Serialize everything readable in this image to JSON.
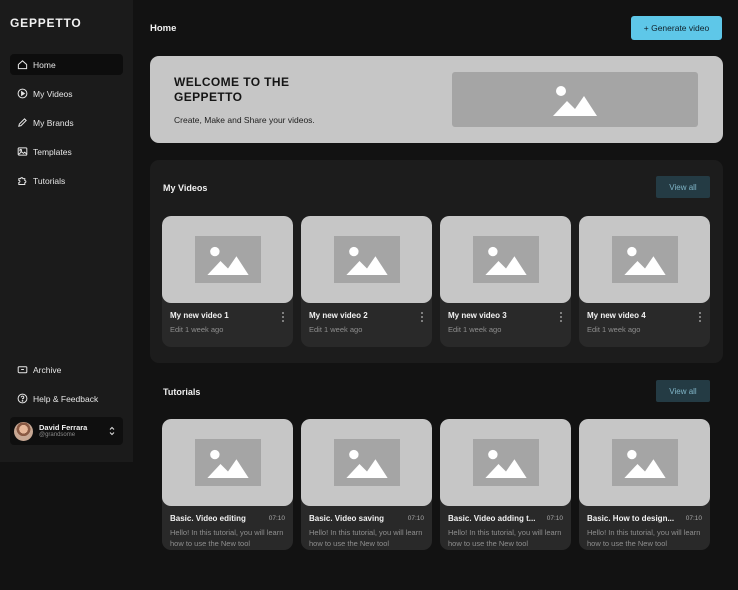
{
  "app": {
    "logo": "GEPPETTO"
  },
  "sidebar": {
    "items": [
      {
        "label": "Home",
        "icon": "home-icon"
      },
      {
        "label": "My Videos",
        "icon": "play-circle-icon"
      },
      {
        "label": "My Brands",
        "icon": "pencil-icon"
      },
      {
        "label": "Templates",
        "icon": "image-icon"
      },
      {
        "label": "Tutorials",
        "icon": "puzzle-icon"
      }
    ],
    "bottom_items": [
      {
        "label": "Archive",
        "icon": "archive-icon"
      },
      {
        "label": "Help & Feedback",
        "icon": "help-icon"
      }
    ],
    "user": {
      "name": "David Ferrara",
      "handle": "@grandsome"
    }
  },
  "header": {
    "title": "Home",
    "generate_label": "+ Generate video"
  },
  "banner": {
    "title": "WELCOME TO THE GEPPETTO",
    "subtitle": "Create, Make and Share your videos."
  },
  "my_videos": {
    "title": "My Videos",
    "view_all": "View all",
    "items": [
      {
        "title": "My new video 1",
        "meta": "Edit 1 week ago"
      },
      {
        "title": "My new video 2",
        "meta": "Edit 1 week ago"
      },
      {
        "title": "My new video 3",
        "meta": "Edit 1 week ago"
      },
      {
        "title": "My new video 4",
        "meta": "Edit 1 week ago"
      }
    ]
  },
  "tutorials": {
    "title": "Tutorials",
    "view_all": "View all",
    "items": [
      {
        "title": "Basic. Video editing",
        "duration": "07:10",
        "desc": "Hello! In this tutorial, you will learn how to use the New tool"
      },
      {
        "title": "Basic. Video saving",
        "duration": "07:10",
        "desc": "Hello! In this tutorial, you will learn how to use the New tool"
      },
      {
        "title": "Basic. Video adding t...",
        "duration": "07:10",
        "desc": "Hello! In this tutorial, you will learn how to use the New tool"
      },
      {
        "title": "Basic. How to design...",
        "duration": "07:10",
        "desc": "Hello! In this tutorial, you will learn how to use the New tool"
      }
    ]
  },
  "colors": {
    "accent": "#5ec7e8",
    "background": "#121212",
    "sidebar": "#1b1b1b",
    "placeholder": "#c6c6c6"
  }
}
